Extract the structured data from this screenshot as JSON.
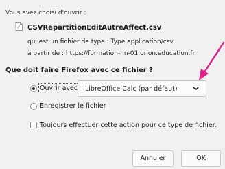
{
  "dialog": {
    "intro": "Vous avez choisi d'ouvrir :",
    "file": {
      "name": "CSVRepartitionEditAutreAffect.csv",
      "type_line": "qui est un fichier de type : Type application/csv",
      "from_line": "à partir de : https://formation-hn-01.orion.education.fr"
    },
    "question": "Que doit faire Firefox avec ce fichier ?",
    "open_with": {
      "label_first": "O",
      "label_rest": "uvrir avec",
      "selected": true,
      "app": "LibreOffice Calc (par défaut)"
    },
    "save": {
      "label_first": "E",
      "label_rest": "nregistrer le fichier",
      "selected": false
    },
    "always": {
      "label_first": "T",
      "label_rest": "oujours effectuer cette action pour ce type de fichier.",
      "checked": false
    },
    "buttons": {
      "cancel": "Annuler",
      "ok": "OK"
    }
  },
  "colors": {
    "annotation_arrow": "#e0208a"
  },
  "icons": [
    "file-icon",
    "chevron-down-icon",
    "annotation-arrow"
  ]
}
